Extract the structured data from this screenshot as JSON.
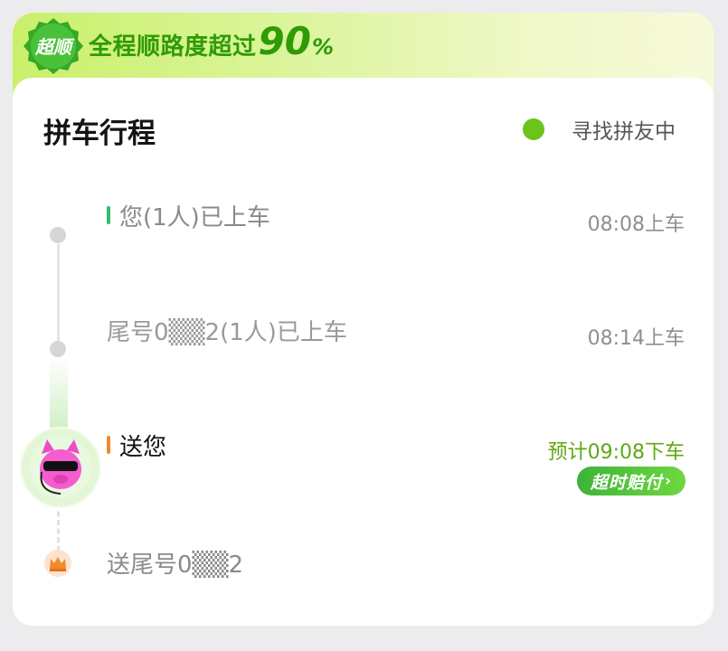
{
  "banner": {
    "badge": "超顺",
    "text": "全程顺路度超过",
    "percent_number": "90",
    "percent_sign": "%"
  },
  "header": {
    "title": "拼车行程",
    "status": "寻找拼友中"
  },
  "timeline": [
    {
      "text": "您(1人)已上车",
      "time": "08:08上车"
    },
    {
      "text": "尾号0▒▒2(1人)已上车",
      "time": "08:14上车"
    },
    {
      "text": "送您",
      "time": "预计09:08下车",
      "badge": "超时赔付"
    },
    {
      "text": "送尾号0▒▒2"
    }
  ],
  "colors": {
    "accent_green": "#6cc31c",
    "banner_text": "#2f9b06",
    "boarded_bar": "#2fbf6a",
    "current_bar": "#f08a2a"
  },
  "icons": [
    "super-smooth-badge-icon",
    "avatar-pig-icon",
    "crown-icon"
  ]
}
